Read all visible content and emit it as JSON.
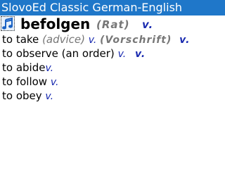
{
  "app": {
    "title": "SlovoEd Classic German-English"
  },
  "entry": {
    "headword": "befolgen",
    "label": "(Rat)",
    "pos": "v.",
    "senses": [
      {
        "text": "to take",
        "note": "(advice)",
        "pos": "v.",
        "label": "(Vorschrift)",
        "pos2": "v."
      },
      {
        "text": "to observe (an order)",
        "pos": "v.",
        "pos2": "v."
      },
      {
        "text": "to abide",
        "pos": "v."
      },
      {
        "text": "to follow",
        "pos": "v."
      },
      {
        "text": "to obey",
        "pos": "v."
      }
    ]
  },
  "icons": {
    "sound": "music-note-icon"
  },
  "colors": {
    "titlebar": "#1f77c9",
    "pos": "#1a2bb0",
    "label": "#777777"
  }
}
